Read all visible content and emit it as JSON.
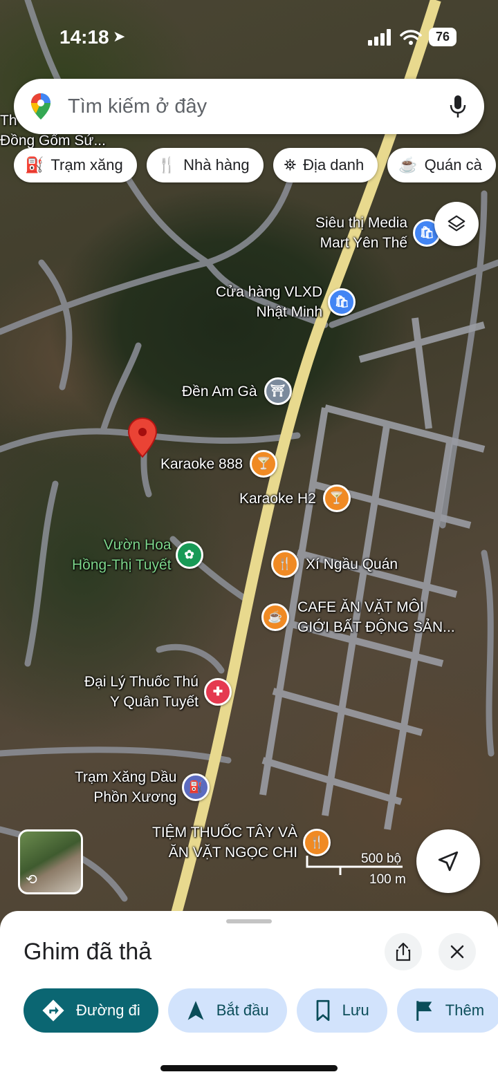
{
  "status_bar": {
    "time": "14:18",
    "battery": "76"
  },
  "search": {
    "placeholder": "Tìm kiếm ở đây"
  },
  "chips": [
    {
      "label": "Trạm xăng",
      "icon": "gas-station-icon"
    },
    {
      "label": "Nhà hàng",
      "icon": "restaurant-icon"
    },
    {
      "label": "Địa danh",
      "icon": "landmark-icon"
    },
    {
      "label": "Quán cà",
      "icon": "coffee-icon"
    }
  ],
  "pois": {
    "dong_gom": "Đồng Gốm Sứ...",
    "dong_gom_prefix": "Th",
    "sieu_thi": [
      "Siêu thị Media",
      "Mart Yên Thế"
    ],
    "vlxd": [
      "Cửa hàng VLXD",
      "Nhật Minh"
    ],
    "den_am_ga": "Đền Am Gà",
    "karaoke_888": "Karaoke 888",
    "karaoke_h2": "Karaoke H2",
    "vuon_hoa": [
      "Vườn Hoa",
      "Hồng-Thị Tuyết"
    ],
    "xi_ngau": "Xí Ngầu Quán",
    "cafe": [
      "CAFE ĂN VẶT MÔI",
      "GIỚI BẤT ĐỘNG SẢN..."
    ],
    "dai_ly": [
      "Đại Lý Thuốc Thú",
      "Y Quân Tuyết"
    ],
    "tram_xang": [
      "Trạm Xăng Dầu",
      "Phồn Xương"
    ],
    "tiem_thuoc": [
      "TIỆM THUỐC TÂY VÀ",
      "ĂN VẶT NGỌC CHI"
    ]
  },
  "scale": {
    "imperial": "500 bộ",
    "metric": "100 m"
  },
  "sheet": {
    "title": "Ghim đã thả",
    "actions": [
      {
        "label": "Đường đi",
        "icon": "directions-icon"
      },
      {
        "label": "Bắt đầu",
        "icon": "navigation-arrow-icon"
      },
      {
        "label": "Lưu",
        "icon": "bookmark-icon"
      },
      {
        "label": "Thêm",
        "icon": "flag-icon"
      }
    ]
  },
  "colors": {
    "primary_action": "#0b6672",
    "secondary_action": "#d2e3fc",
    "pin": "#ea4335"
  }
}
